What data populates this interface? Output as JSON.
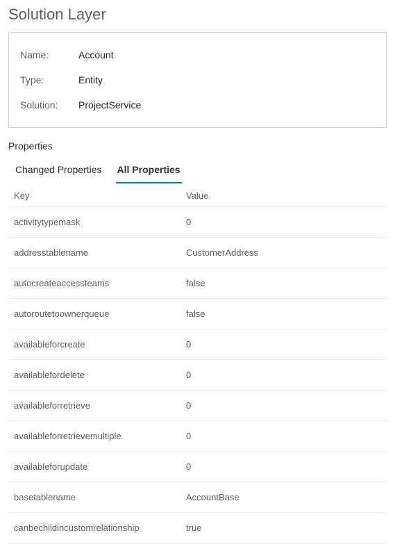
{
  "page_title": "Solution Layer",
  "summary": {
    "name_label": "Name:",
    "name_value": "Account",
    "type_label": "Type:",
    "type_value": "Entity",
    "solution_label": "Solution:",
    "solution_value": "ProjectService"
  },
  "section_header": "Properties",
  "tabs": {
    "changed": "Changed Properties",
    "all": "All Properties"
  },
  "table_header": {
    "key": "Key",
    "value": "Value"
  },
  "properties": [
    {
      "key": "activitytypemask",
      "value": "0"
    },
    {
      "key": "addresstablename",
      "value": "CustomerAddress"
    },
    {
      "key": "autocreateaccessteams",
      "value": "false"
    },
    {
      "key": "autoroutetoownerqueue",
      "value": "false"
    },
    {
      "key": "availableforcreate",
      "value": "0"
    },
    {
      "key": "availablefordelete",
      "value": "0"
    },
    {
      "key": "availableforretrieve",
      "value": "0"
    },
    {
      "key": "availableforretrievemultiple",
      "value": "0"
    },
    {
      "key": "availableforupdate",
      "value": "0"
    },
    {
      "key": "basetablename",
      "value": "AccountBase"
    },
    {
      "key": "canbechildincustomrelationship",
      "value": "true"
    }
  ]
}
